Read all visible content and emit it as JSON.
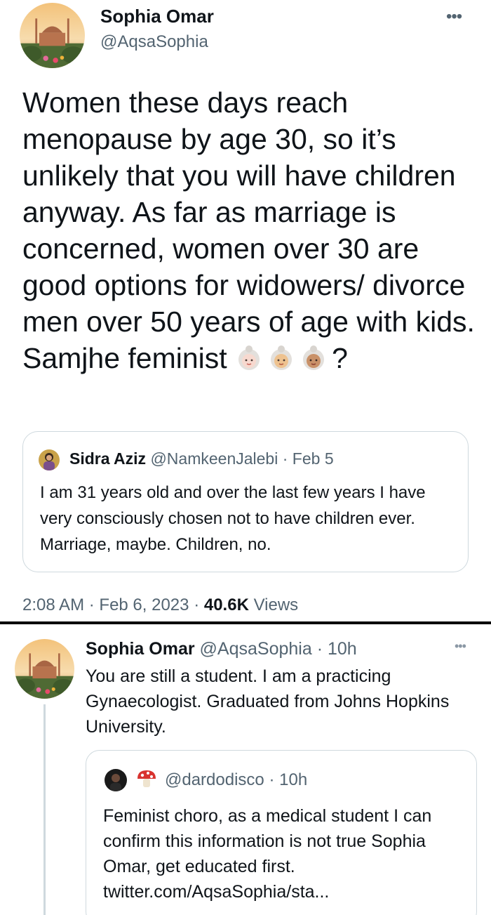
{
  "tweet": {
    "author_name": "Sophia Omar",
    "author_handle": "@AqsaSophia",
    "more_icon": "•••",
    "text": "Women these days reach menopause by age 30, so it’s unlikely that you will have children anyway. As far as marriage is concerned, women over 30 are good options for widowers/ divorce men over 50 years of age with kids. Samjhe feminist",
    "text_suffix": "?",
    "emojis": [
      "old-woman-light-skin-emoji",
      "old-woman-medium-light-skin-emoji",
      "old-woman-medium-skin-emoji"
    ],
    "quoted": {
      "author_name": "Sidra Aziz",
      "author_handle": "@NamkeenJalebi",
      "separator": "·",
      "date": "Feb 5",
      "text": "I am 31 years old and over the last few years I have very consciously chosen not to have children ever. Marriage, maybe. Children, no."
    },
    "meta": {
      "time": "2:08 AM",
      "separator": "·",
      "date": "Feb 6, 2023",
      "views_count": "40.6K",
      "views_label": "Views"
    }
  },
  "reply": {
    "author_name": "Sophia Omar",
    "author_handle": "@AqsaSophia",
    "separator": "·",
    "age": "10h",
    "more_icon": "•••",
    "text": "You are still a student. I am a practicing Gynaecologist. Graduated from Johns Hopkins University.",
    "quoted": {
      "author_handle": "@dardodisco",
      "separator": "·",
      "age": "10h",
      "text": "Feminist choro, as a medical student I can confirm this information is not true Sophia Omar, get educated first. twitter.com/AqsaSophia/sta..."
    }
  },
  "colors": {
    "text_primary": "#0f1419",
    "text_secondary": "#536471",
    "border": "#cfd9de",
    "divider": "#000000"
  }
}
